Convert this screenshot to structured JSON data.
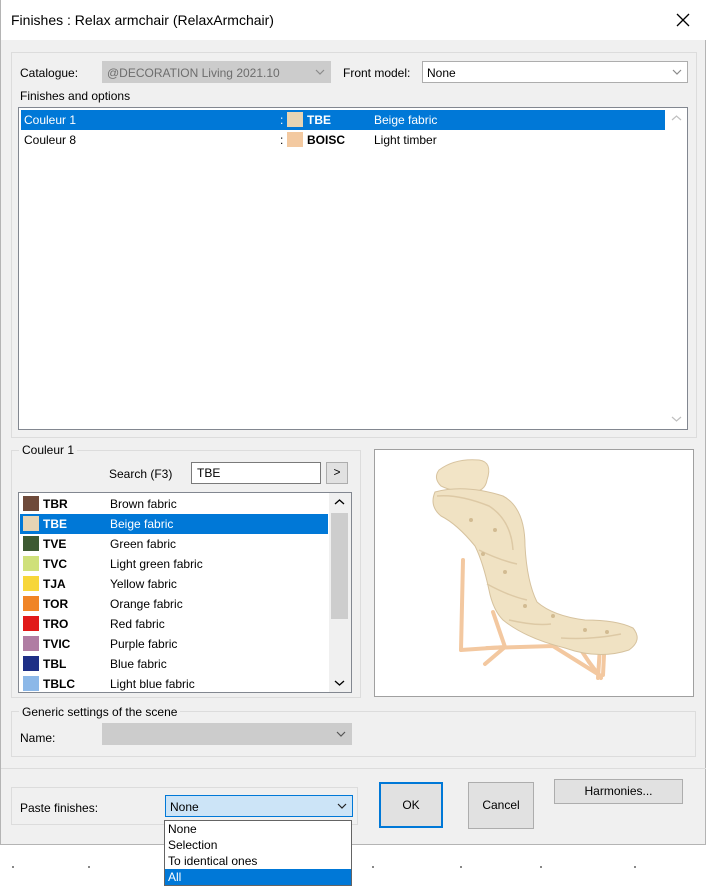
{
  "window": {
    "title": "Finishes : Relax armchair (RelaxArmchair)"
  },
  "top": {
    "catalogue_label": "Catalogue:",
    "catalogue_value": "@DECORATION Living 2021.10",
    "front_model_label": "Front model:",
    "front_model_value": "None",
    "finishes_label": "Finishes and options"
  },
  "finishes": [
    {
      "name": "Couleur 1",
      "sep": ":",
      "code": "TBE",
      "desc": "Beige fabric",
      "color": "#e6d4b4",
      "selected": true
    },
    {
      "name": "Couleur 8",
      "sep": ":",
      "code": "BOISC",
      "desc": "Light timber",
      "color": "#f3c9a0",
      "selected": false
    }
  ],
  "color_group": {
    "label": "Couleur 1",
    "search_label": "Search (F3)",
    "search_value": "TBE",
    "go_label": ">",
    "items": [
      {
        "code": "TBR",
        "desc": "Brown fabric",
        "color": "#6e4a3a"
      },
      {
        "code": "TBE",
        "desc": "Beige fabric",
        "color": "#e6d4b4"
      },
      {
        "code": "TVE",
        "desc": "Green fabric",
        "color": "#3d5a32"
      },
      {
        "code": "TVC",
        "desc": "Light green fabric",
        "color": "#cfe07a"
      },
      {
        "code": "TJA",
        "desc": "Yellow fabric",
        "color": "#f7d63a"
      },
      {
        "code": "TOR",
        "desc": "Orange fabric",
        "color": "#f08426"
      },
      {
        "code": "TRO",
        "desc": "Red fabric",
        "color": "#e11a1a"
      },
      {
        "code": "TVIC",
        "desc": "Purple fabric",
        "color": "#b07da3"
      },
      {
        "code": "TBL",
        "desc": "Blue fabric",
        "color": "#1e2f86"
      },
      {
        "code": "TBLC",
        "desc": "Light blue fabric",
        "color": "#8cb8e8"
      }
    ]
  },
  "scene": {
    "label": "Generic settings of the scene",
    "name_label": "Name:",
    "name_value": ""
  },
  "bottom": {
    "paste_label": "Paste finishes:",
    "paste_value": "None",
    "ok_label": "OK",
    "cancel_label": "Cancel",
    "harmonies_label": "Harmonies...",
    "paste_options": [
      "None",
      "Selection",
      "To identical ones",
      "All"
    ]
  },
  "colors": {
    "selection": "#0078d7",
    "dialog_bg": "#f0f0f0"
  }
}
